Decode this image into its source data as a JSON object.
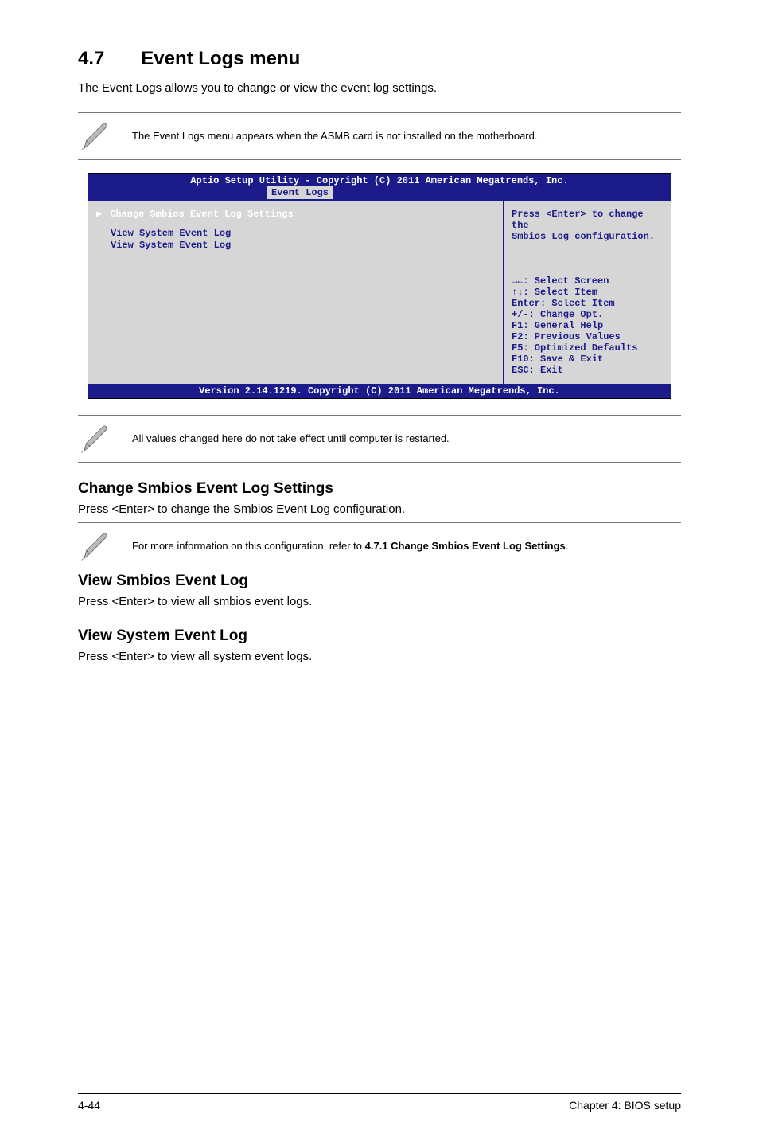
{
  "heading": {
    "number": "4.7",
    "title": "Event Logs menu"
  },
  "intro": "The Event Logs allows you to change or view the event log settings.",
  "note_top": "The Event Logs menu appears when the ASMB card is not installed on the motherboard.",
  "bios": {
    "bar_title": "Aptio Setup Utility - Copyright (C) 2011 American Megatrends, Inc.",
    "tab": "Event Logs",
    "items": {
      "change": "Change Smbios Event Log Settings",
      "view1": "View System Event Log",
      "view2": "View System Event Log"
    },
    "help_top_line1": "Press <Enter> to change the",
    "help_top_line2": "Smbios Log configuration.",
    "keys": {
      "k1": "→←: Select Screen",
      "k2": "↑↓:  Select Item",
      "k3": "Enter: Select Item",
      "k4": "+/-: Change Opt.",
      "k5": "F1: General Help",
      "k6": "F2: Previous Values",
      "k7": "F5: Optimized Defaults",
      "k8": "F10: Save & Exit",
      "k9": "ESC: Exit"
    },
    "footer": "Version 2.14.1219. Copyright (C) 2011 American Megatrends, Inc."
  },
  "note_after_bios": "All values changed here do not take effect until computer is restarted.",
  "sections": {
    "s1_head": "Change Smbios Event Log Settings",
    "s1_body": "Press <Enter> to change the Smbios Event Log configuration.",
    "s1_note_prefix": "For more information on this configuration, refer to ",
    "s1_note_bold": "4.7.1 Change Smbios Event Log Settings",
    "s1_note_suffix": ".",
    "s2_head": "View Smbios Event Log",
    "s2_body": "Press <Enter> to view all smbios event logs.",
    "s3_head": "View System Event Log",
    "s3_body": "Press <Enter> to view all system event logs."
  },
  "footer": {
    "left": "4-44",
    "right": "Chapter 4: BIOS setup"
  }
}
